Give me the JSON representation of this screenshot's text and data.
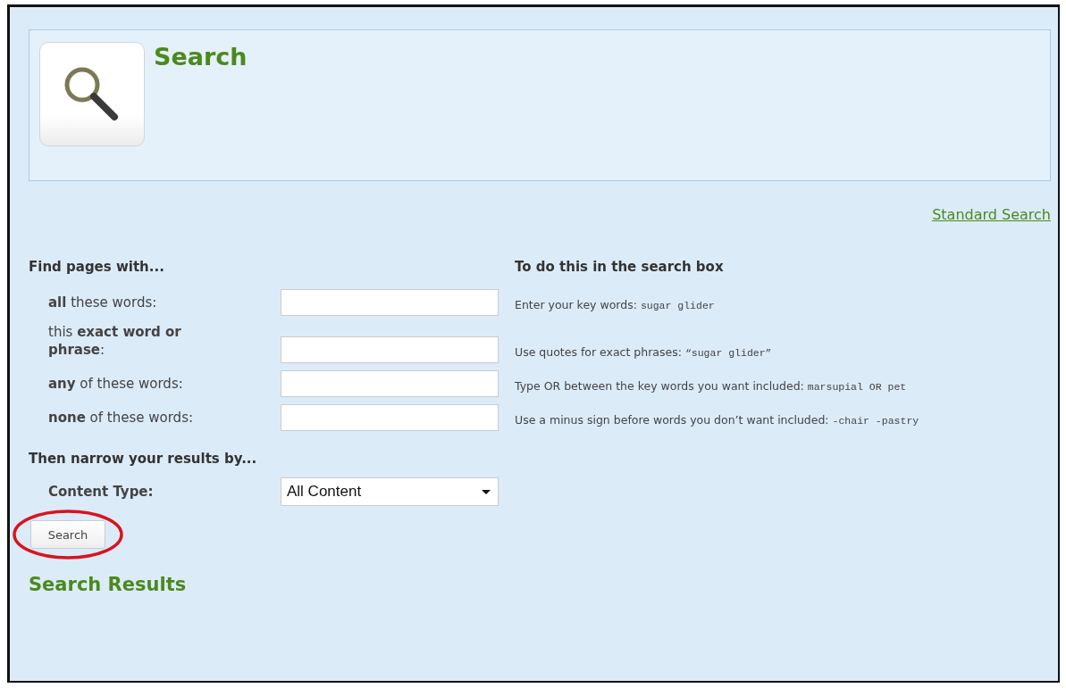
{
  "header": {
    "title": "Search"
  },
  "standard_search_link": "Standard Search",
  "find_section": {
    "heading": "Find pages with...",
    "hint_heading": "To do this in the search box",
    "rows": [
      {
        "label": "**all** these words:",
        "hint": "Enter your key words:",
        "example": "sugar glider"
      },
      {
        "label": "this **exact word or phrase**:",
        "hint": "Use quotes for exact phrases:",
        "example": "“sugar glider”"
      },
      {
        "label": "**any** of these words:",
        "hint": "Type OR between the key words you want included:",
        "example": "marsupial OR pet"
      },
      {
        "label": "**none** of these words:",
        "hint": "Use a minus sign before words you don’t want included:",
        "example": "-chair -pastry"
      }
    ]
  },
  "narrow_section": {
    "heading": "Then narrow your results by...",
    "content_type": {
      "label": "Content Type:",
      "value": "All Content"
    }
  },
  "search_button": {
    "label": "Search",
    "circled": true
  },
  "results_heading": "Search Results"
}
